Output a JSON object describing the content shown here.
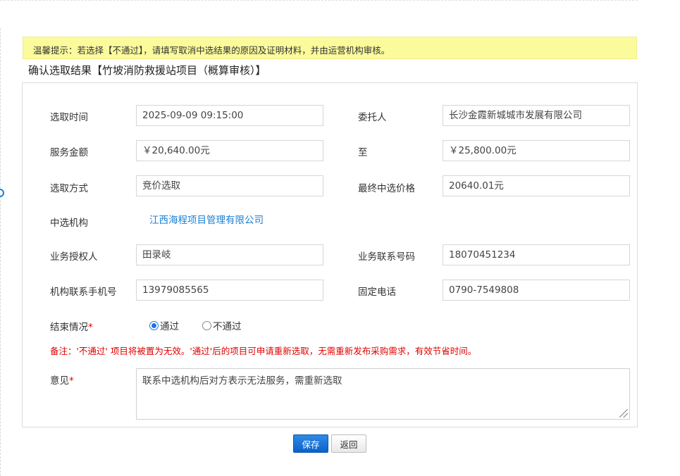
{
  "notice": "温馨提示：若选择【不通过】，请填写取消中选结果的原因及证明材料，并由运营机构审核。",
  "heading": "确认选取结果【竹坡消防救援站项目（概算审核）】",
  "form": {
    "select_time": {
      "label": "选取时间",
      "value": "2025-09-09 09:15:00"
    },
    "client": {
      "label": "委托人",
      "value": "长沙金霞新城城市发展有限公司"
    },
    "service_amount": {
      "label": "服务金额",
      "value": "￥20,640.00元"
    },
    "to": {
      "label": "至",
      "value": "￥25,800.00元"
    },
    "select_method": {
      "label": "选取方式",
      "value": "竞价选取"
    },
    "final_price": {
      "label": "最终中选价格",
      "value": "20640.01元"
    },
    "selected_org": {
      "label": "中选机构",
      "value": "江西海程项目管理有限公司"
    },
    "authorized_person": {
      "label": "业务授权人",
      "value": "田录岐"
    },
    "business_phone": {
      "label": "业务联系号码",
      "value": "18070451234"
    },
    "org_mobile": {
      "label": "机构联系手机号",
      "value": "13979085565"
    },
    "landline": {
      "label": "固定电话",
      "value": "0790-7549808"
    },
    "result": {
      "label": "结束情况",
      "required_mark": "*",
      "options": [
        "通过",
        "不通过"
      ],
      "selected": "通过"
    },
    "remark": "备注：'不通过' 项目将被置为无效。'通过'后的项目可申请重新选取，无需重新发布采购需求，有效节省时间。",
    "opinion": {
      "label": "意见",
      "required_mark": "*",
      "value": "联系中选机构后对方表示无法服务，需重新选取"
    }
  },
  "buttons": {
    "save": "保存",
    "back": "返回"
  },
  "colors": {
    "notice_bg": "#fbfb9c",
    "link": "#1a7fd4",
    "required": "#e00000",
    "primary_button": "#1a73e8"
  }
}
